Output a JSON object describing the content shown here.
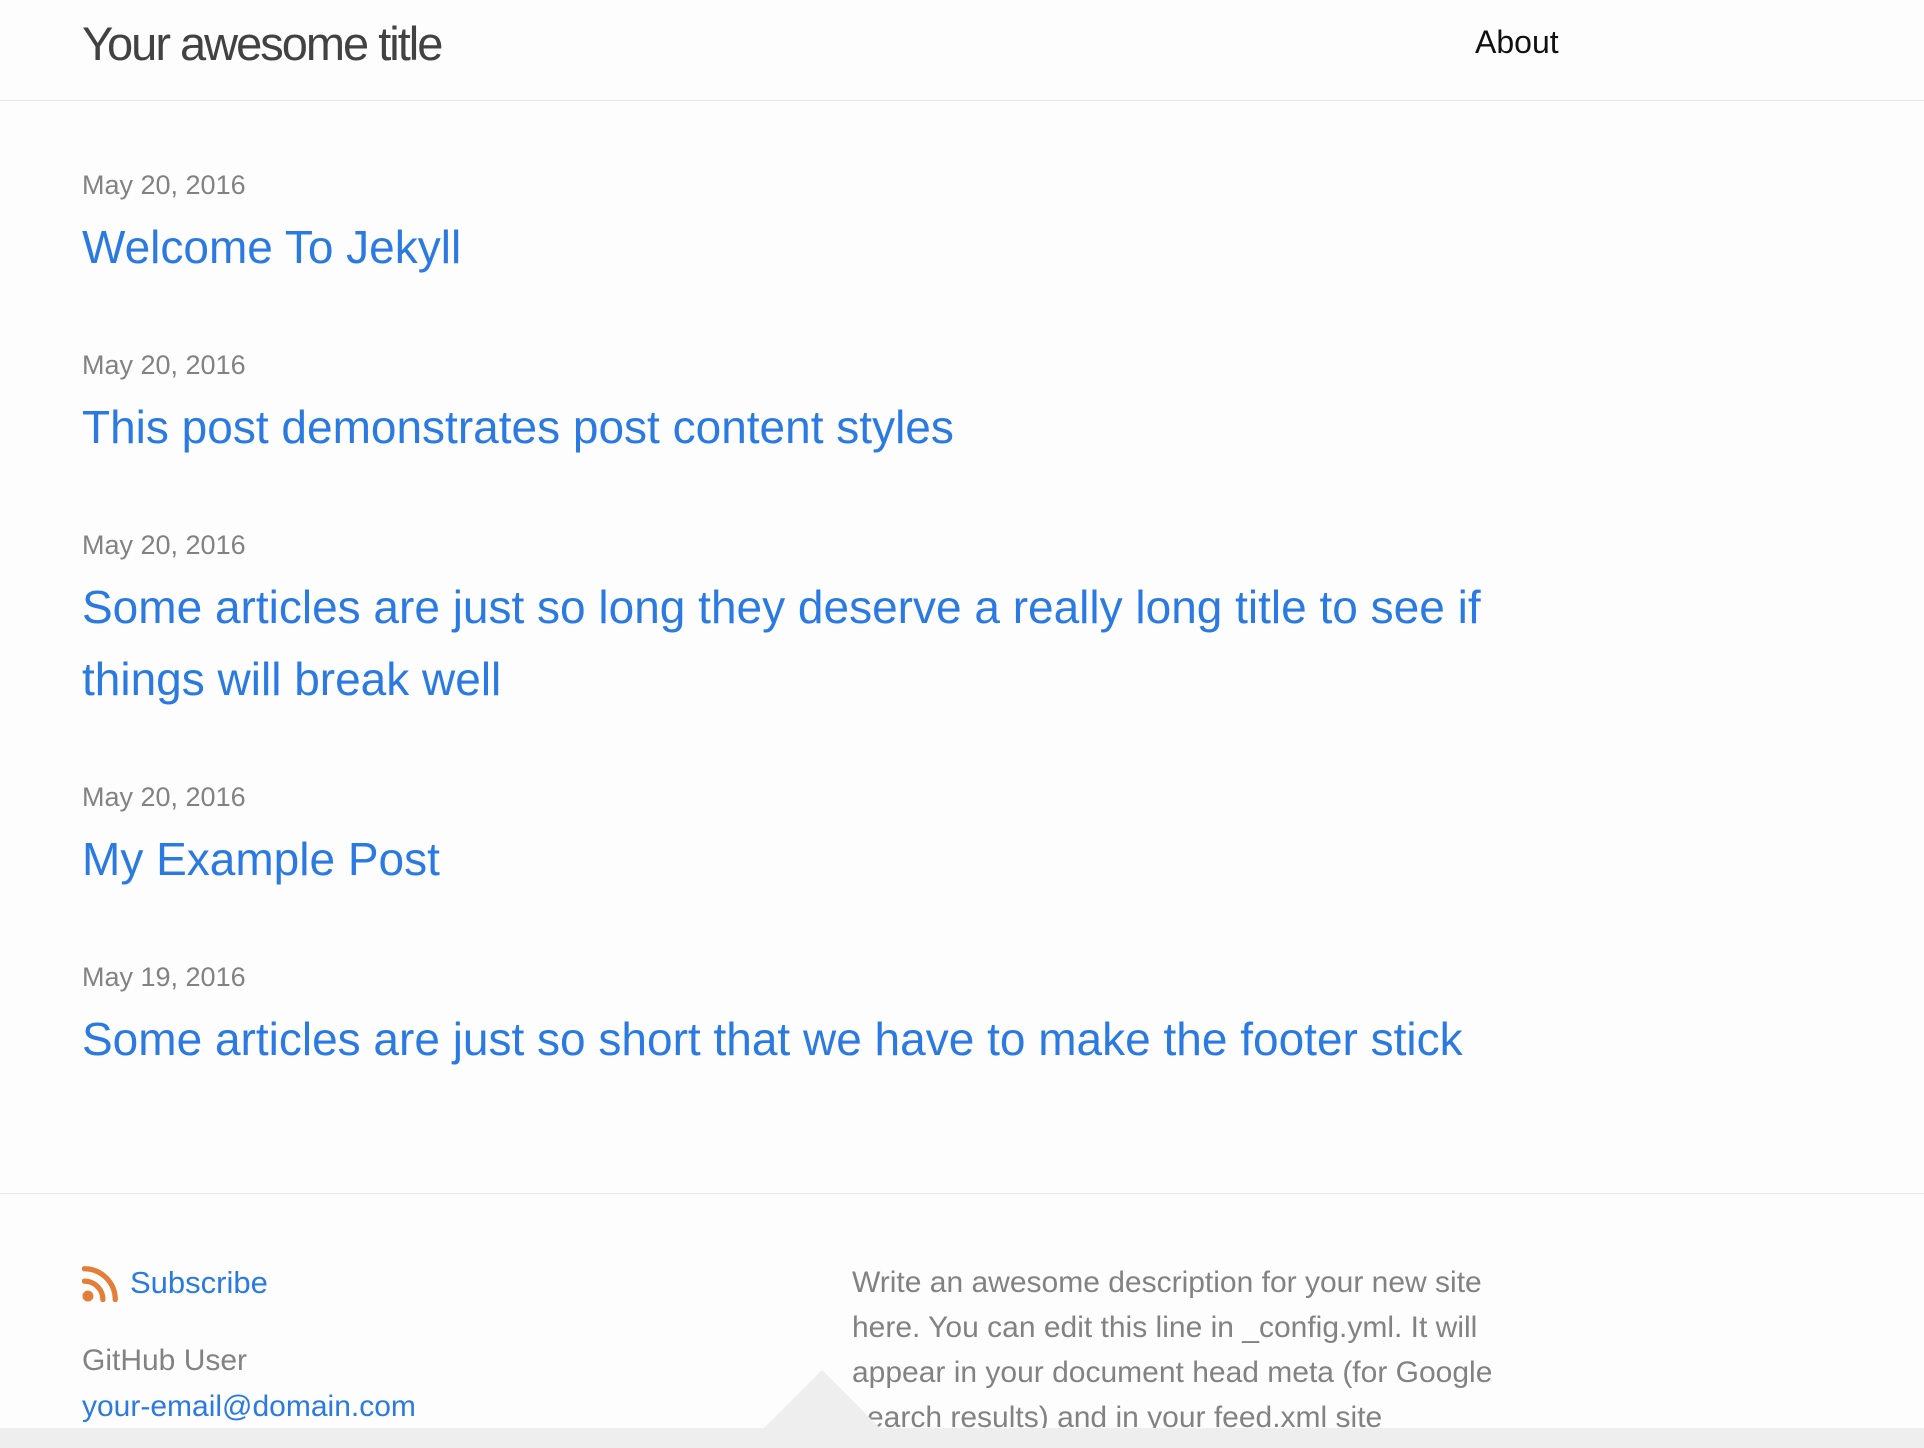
{
  "header": {
    "site_title": "Your awesome title",
    "nav": [
      {
        "label": "About"
      }
    ]
  },
  "posts": [
    {
      "date": "May 20, 2016",
      "title": "Welcome To Jekyll"
    },
    {
      "date": "May 20, 2016",
      "title": "This post demonstrates post content styles"
    },
    {
      "date": "May 20, 2016",
      "title": "Some articles are just so long they deserve a really long title to see if things will break well"
    },
    {
      "date": "May 20, 2016",
      "title": "My Example Post"
    },
    {
      "date": "May 19, 2016",
      "title": "Some articles are just so short that we have to make the footer stick"
    }
  ],
  "footer": {
    "subscribe_label": "Subscribe",
    "name": "GitHub User",
    "email": "your-email@domain.com",
    "description": "Write an awesome description for your new site here. You can edit this line in _config.yml. It will appear in your document head meta (for Google search results) and in your feed.xml site",
    "rss_icon": "rss-icon"
  },
  "colors": {
    "link": "#2a7ae2",
    "muted": "#828282",
    "title": "#424242",
    "rss": "#e47d36"
  }
}
